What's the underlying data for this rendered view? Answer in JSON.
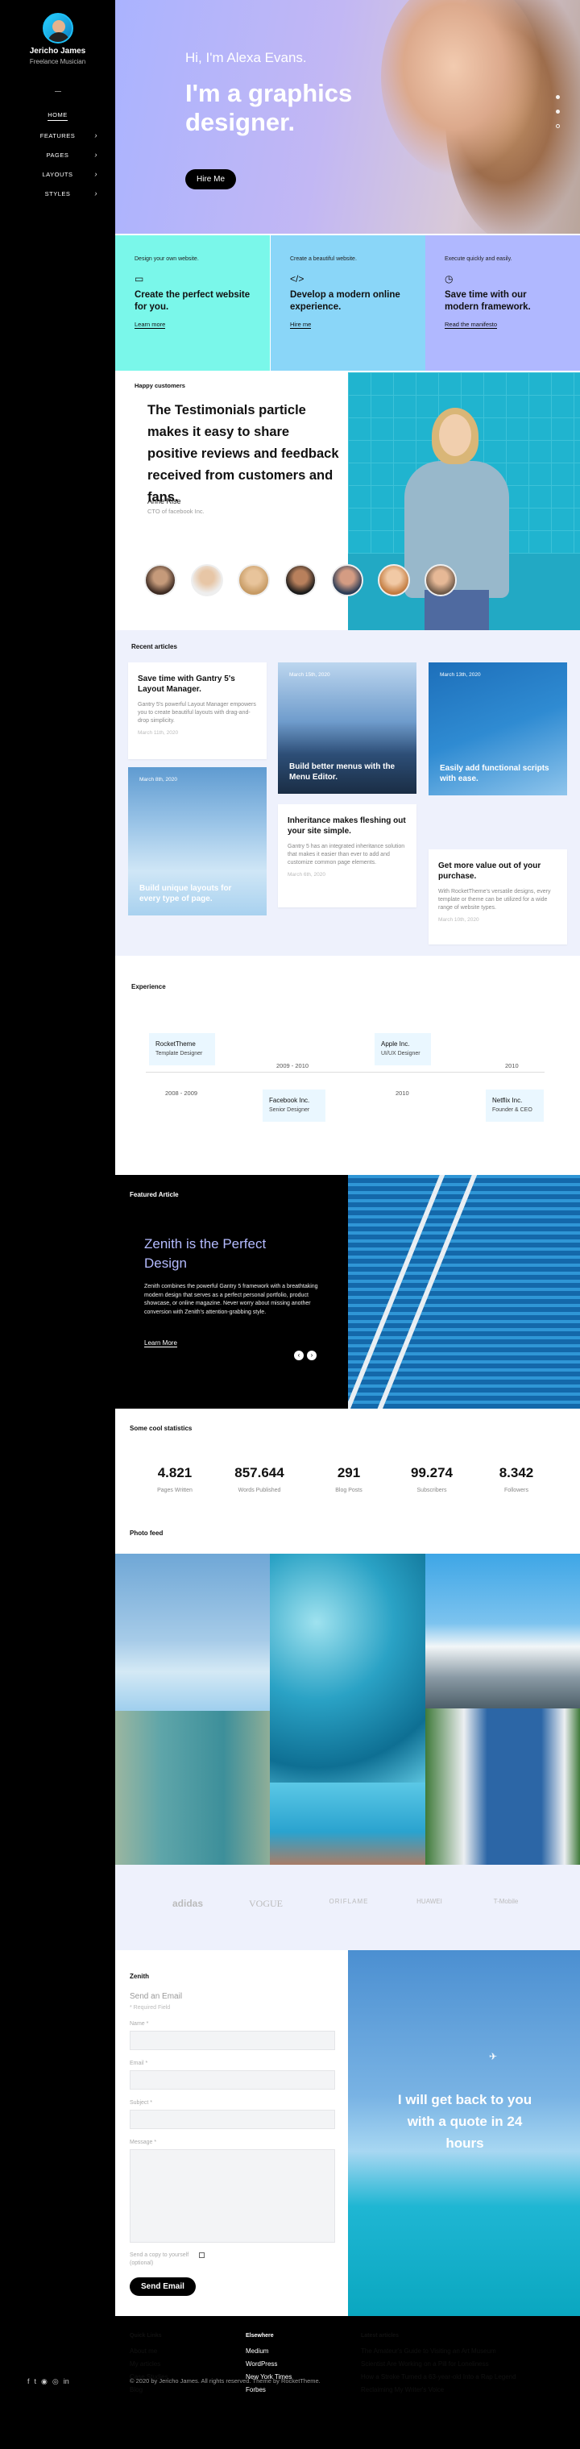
{
  "sidebar": {
    "name": "Jericho James",
    "role": "Freelance Musician",
    "nav": [
      {
        "label": "HOME",
        "active": true
      },
      {
        "label": "FEATURES"
      },
      {
        "label": "PAGES"
      },
      {
        "label": "LAYOUTS"
      },
      {
        "label": "STYLES"
      }
    ]
  },
  "hero": {
    "sub": "Hi, I'm Alexa Evans.",
    "title": "I'm a graphics designer.",
    "button": "Hire Me"
  },
  "features": [
    {
      "small": "Design your own website.",
      "title": "Create the perfect website for you.",
      "link": "Learn more",
      "icon": "monitor-icon",
      "color": "#7af7ea"
    },
    {
      "small": "Create a beautiful website.",
      "title": "Develop a modern online experience.",
      "link": "Hire me",
      "icon": "code-icon",
      "color": "#8ad6f8"
    },
    {
      "small": "Execute quickly and easily.",
      "title": "Save time with our modern framework.",
      "link": "Read the manifesto",
      "icon": "clock-icon",
      "color": "#b0b8ff"
    }
  ],
  "testimonials": {
    "section": "Happy customers",
    "quote": "The Testimonials particle makes it easy to share positive reviews and feedback received from customers and fans.",
    "name": "Anne Rise",
    "role": "CTO of facebook Inc."
  },
  "articles": {
    "section": "Recent articles",
    "items": [
      {
        "title": "Save time with Gantry 5's Layout Manager.",
        "text": "Gantry 5's powerful Layout Manager empowers you to create beautiful layouts with drag-and-drop simplicity.",
        "date": "March 11th, 2020"
      },
      {
        "title": "Build better menus with the Menu Editor.",
        "date": "March 15th, 2020"
      },
      {
        "title": "Easily add functional scripts with ease.",
        "date": "March 13th, 2020"
      },
      {
        "title": "Build unique layouts for every type of page.",
        "date": "March 8th, 2020"
      },
      {
        "title": "Inheritance makes fleshing out your site simple.",
        "text": "Gantry 5 has an integrated inheritance solution that makes it easier than ever to add and customize common page elements.",
        "date": "March 6th, 2020"
      },
      {
        "title": "Get more value out of your purchase.",
        "text": "With RocketTheme's versatile designs, every template or theme can be utilized for a wide range of website types.",
        "date": "March 10th, 2020"
      }
    ]
  },
  "experience": {
    "section": "Experience",
    "items": [
      {
        "company": "RocketTheme",
        "role": "Template Designer",
        "year": "2008 - 2009"
      },
      {
        "company": "Facebook Inc.",
        "role": "Senior Designer",
        "year": "2009 - 2010"
      },
      {
        "company": "Apple Inc.",
        "role": "UI/UX Designer",
        "year": "2010"
      },
      {
        "company": "Netflix Inc.",
        "role": "Founder & CEO",
        "year": "2010"
      }
    ]
  },
  "featured": {
    "section": "Featured Article",
    "title": "Zenith is the Perfect Design",
    "text": "Zenith combines the powerful Gantry 5 framework with a breathtaking modern design that serves as a perfect personal portfolio, product showcase, or online magazine. Never worry about missing another conversion with Zenith's attention-grabbing style.",
    "link": "Learn More"
  },
  "stats": {
    "section": "Some cool statistics",
    "items": [
      {
        "n": "4.821",
        "l": "Pages Written"
      },
      {
        "n": "857.644",
        "l": "Words Published"
      },
      {
        "n": "291",
        "l": "Blog Posts"
      },
      {
        "n": "99.274",
        "l": "Subscribers"
      },
      {
        "n": "8.342",
        "l": "Followers"
      }
    ]
  },
  "photos": {
    "section": "Photo feed"
  },
  "logos": [
    "adidas",
    "VOGUE",
    "ORIFLAME",
    "HUAWEI",
    "T-Mobile"
  ],
  "contact": {
    "section": "Zenith",
    "subtitle": "Send an Email",
    "required": "* Required Field",
    "fields": [
      "Name *",
      "Email *",
      "Subject *",
      "Message *"
    ],
    "checkbox": "Send a copy to yourself (optional)",
    "button": "Send Email"
  },
  "beach": {
    "quote": "I will get back to you with a quote in 24 hours"
  },
  "footer": {
    "cols": [
      {
        "title": "Quick Links",
        "links": [
          "About me",
          "My articles",
          "Case Studies",
          "Blog"
        ]
      },
      {
        "title": "Elsewhere",
        "links": [
          "Medium",
          "WordPress",
          "New York Times",
          "Forbes"
        ]
      },
      {
        "title": "Latest articles",
        "links": [
          "The Amateur's Guide to Visiting an Art Museum",
          "Scientist Are Working on a Pill for Loneliness",
          "How a Stroke Turned a 63-year-old Into a Rap Legend",
          "Reclaiming My Writer's Voice"
        ]
      }
    ],
    "copy": "© 2020 by Jericho James. All rights reserved. Theme by RocketTheme."
  }
}
